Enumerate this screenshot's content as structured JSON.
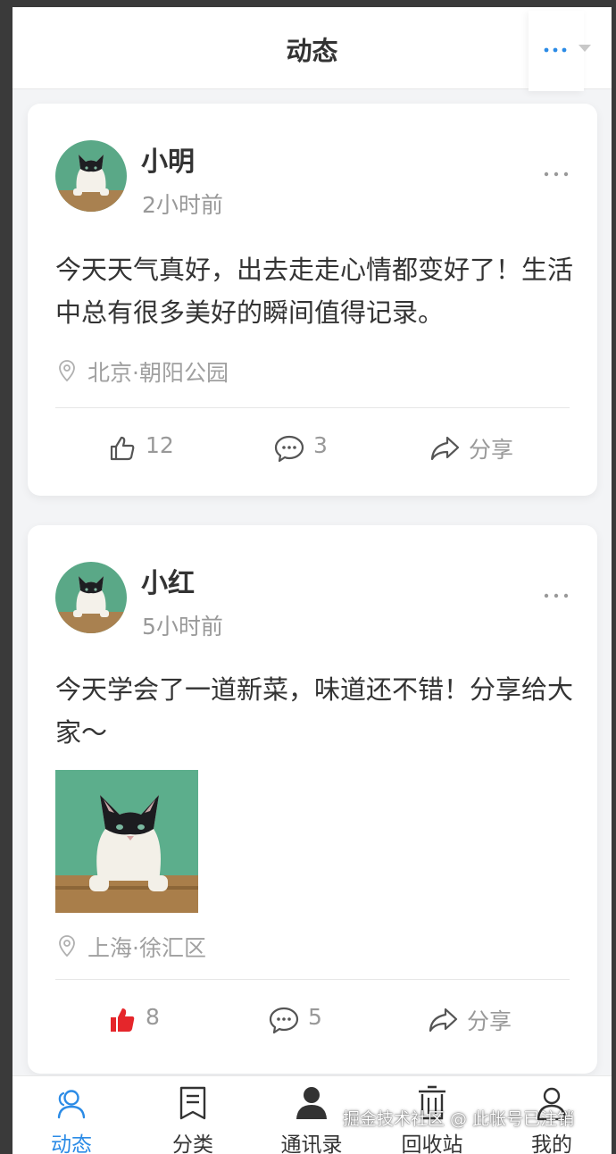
{
  "header": {
    "title": "动态",
    "accent_color": "#2b8be6"
  },
  "posts": [
    {
      "user_name": "小明",
      "time": "2小时前",
      "text": "今天天气真好，出去走走心情都变好了！生活中总有很多美好的瞬间值得记录。",
      "location": "北京·朝阳公园",
      "likes": "12",
      "liked": false,
      "comments": "3",
      "share_label": "分享"
    },
    {
      "user_name": "小红",
      "time": "5小时前",
      "text": "今天学会了一道新菜，味道还不错！分享给大家～",
      "location": "上海·徐汇区",
      "likes": "8",
      "liked": true,
      "liked_color": "#e5262b",
      "comments": "5",
      "share_label": "分享"
    }
  ],
  "tabbar": {
    "active_index": 0,
    "items": [
      {
        "label": "动态",
        "icon": "user-group-icon"
      },
      {
        "label": "分类",
        "icon": "bookmark-icon"
      },
      {
        "label": "通讯录",
        "icon": "person-icon"
      },
      {
        "label": "回收站",
        "icon": "trash-icon"
      },
      {
        "label": "我的",
        "icon": "user-outline-icon"
      }
    ]
  },
  "watermark": "掘金技术社区 @ 此帐号已注销"
}
